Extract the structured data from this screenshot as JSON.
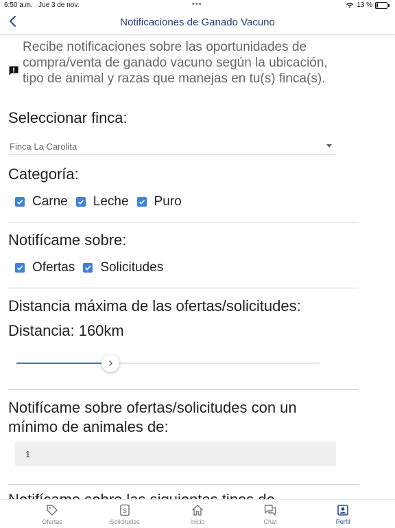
{
  "status_bar": {
    "time": "6:50 a.m.",
    "date": "Jue 3 de nov.",
    "battery": "13 %"
  },
  "header": {
    "title": "Notificaciones de Ganado Vacuno"
  },
  "intro": {
    "text": "Recibe notificaciones sobre las oportunidades de compra/venta de ganado vacuno según la ubicación, tipo de animal y razas que manejas en tu(s) finca(s)."
  },
  "farm": {
    "label": "Seleccionar finca:",
    "selected": "Finca La Carolita"
  },
  "category": {
    "label": "Categoría:",
    "options": [
      {
        "label": "Carne",
        "checked": true
      },
      {
        "label": "Leche",
        "checked": true
      },
      {
        "label": "Puro",
        "checked": true
      }
    ]
  },
  "notify": {
    "label": "Notifícame sobre:",
    "options": [
      {
        "label": "Ofertas",
        "checked": true
      },
      {
        "label": "Solicitudes",
        "checked": true
      }
    ]
  },
  "distance": {
    "label": "Distancia máxima de las ofertas/solicitudes:",
    "value_label": "Distancia: 160km",
    "slider_fraction": 0.31
  },
  "min_animals": {
    "label_line1": "Notifícame sobre ofertas/solicitudes con un",
    "label_line2": "mínimo de animales de:",
    "value": "1"
  },
  "next_section_cut": "Notifícame sobre las siguientes tipos de",
  "tabs": [
    {
      "label": "Ofertas",
      "icon": "tag-icon",
      "active": false
    },
    {
      "label": "Solicitudes",
      "icon": "dollar-doc-icon",
      "active": false
    },
    {
      "label": "Inicio",
      "icon": "home-icon",
      "active": false
    },
    {
      "label": "Chat",
      "icon": "chat-icon",
      "active": false
    },
    {
      "label": "Perfil",
      "icon": "profile-icon",
      "active": true
    }
  ],
  "colors": {
    "accent": "#3f82d6",
    "title": "#243a73",
    "active_tab": "#2a4a8a"
  }
}
